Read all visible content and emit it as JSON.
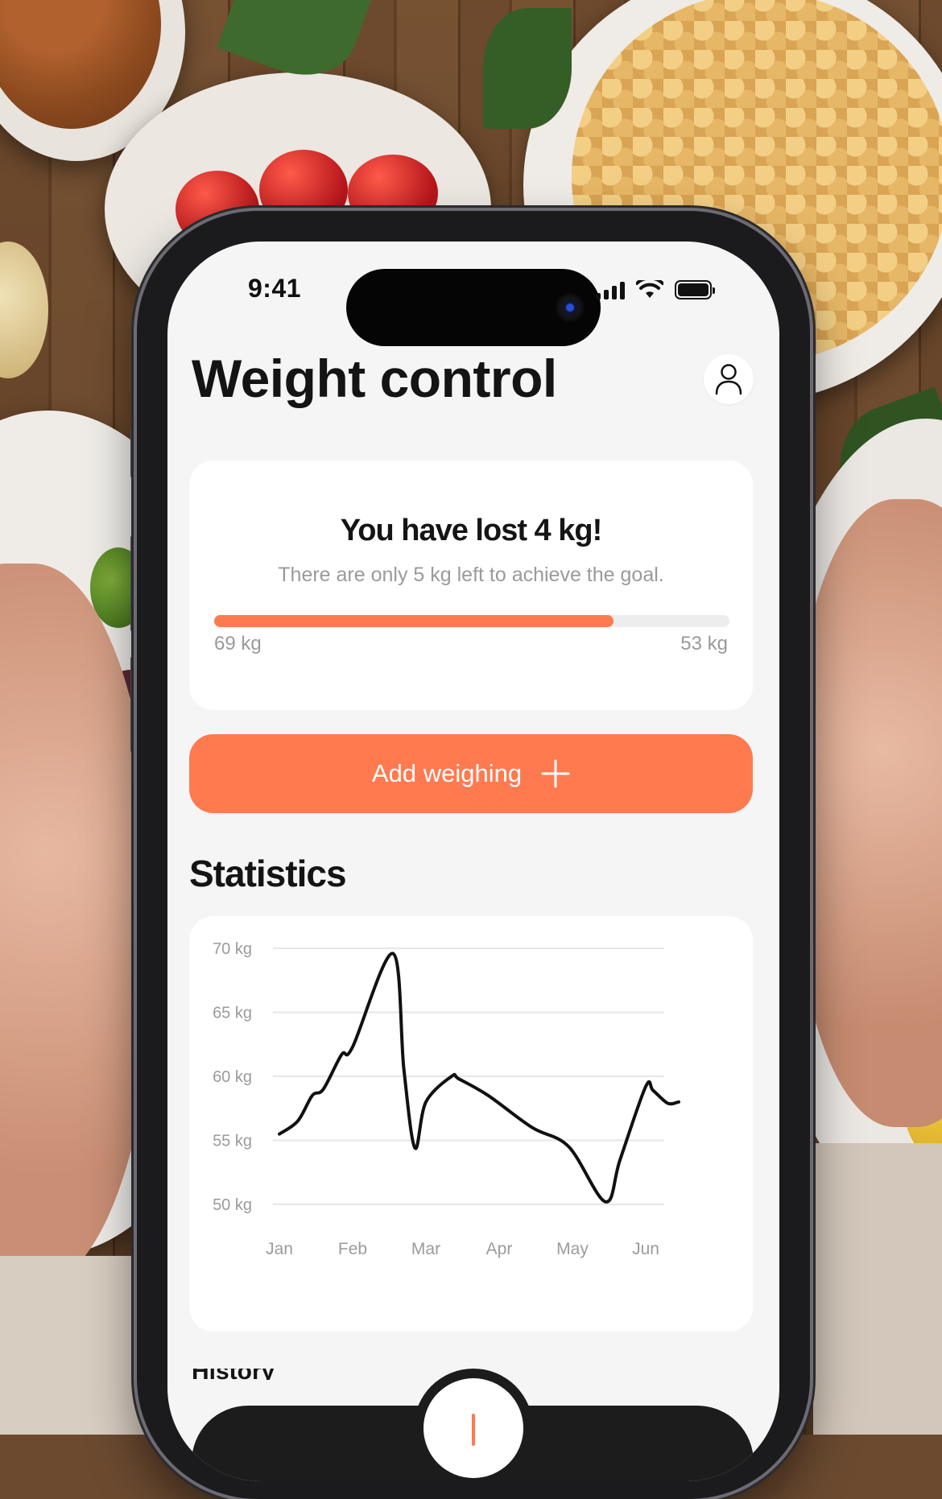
{
  "status_bar": {
    "time": "9:41"
  },
  "header": {
    "title": "Weight control",
    "profile_icon": "person-icon"
  },
  "progress": {
    "title": "You have lost 4 kg!",
    "subtitle": "There are only 5 kg left to achieve the goal.",
    "start_label": "69 kg",
    "end_label": "53 kg",
    "fraction": 0.775,
    "bar_color": "#ff7a4f"
  },
  "add_button": {
    "label": "Add weighing",
    "icon": "plus-icon"
  },
  "statistics": {
    "title": "Statistics"
  },
  "chart_data": {
    "type": "line",
    "y_ticks": [
      {
        "value": 70,
        "label": "70 kg"
      },
      {
        "value": 65,
        "label": "65 kg"
      },
      {
        "value": 60,
        "label": "60 kg"
      },
      {
        "value": 55,
        "label": "55 kg"
      },
      {
        "value": 50,
        "label": "50 kg"
      }
    ],
    "ylim": [
      50,
      70
    ],
    "categories": [
      "Jan",
      "Feb",
      "Mar",
      "Apr",
      "May",
      "Jun"
    ],
    "grid": true,
    "line_color": "#111111",
    "series": [
      {
        "x": [
          0.0,
          0.25,
          0.45,
          0.6,
          0.85,
          1.0,
          1.55,
          1.7,
          1.85,
          2.0,
          2.35,
          2.45,
          2.85,
          3.45,
          3.95,
          4.45,
          4.65,
          5.0,
          5.1,
          5.3,
          5.45
        ],
        "values": [
          55.5,
          56.5,
          58.5,
          59.0,
          61.7,
          62.3,
          69.6,
          60.5,
          54.4,
          58.0,
          60.0,
          59.8,
          58.5,
          56.0,
          54.5,
          50.2,
          53.5,
          59.2,
          58.9,
          57.9,
          58.0
        ]
      }
    ]
  },
  "bottom": {
    "history_title": "History"
  }
}
